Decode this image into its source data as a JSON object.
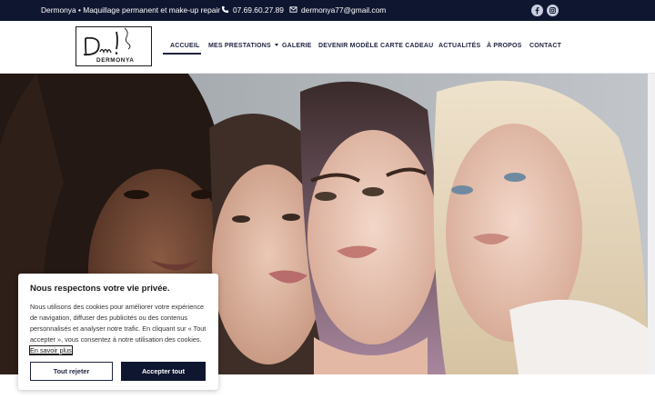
{
  "topbar": {
    "brand_line": "Dermonya • Maquillage permanent et make-up repair",
    "phone": "07.69.60.27.89",
    "email": "dermonya77@gmail.com",
    "phone_icon": "phone-icon",
    "email_icon": "envelope-icon",
    "social": [
      "facebook-icon",
      "instagram-icon"
    ]
  },
  "logo": {
    "script_text": "Dn!",
    "wordmark": "DERMONYA"
  },
  "nav": {
    "items": [
      {
        "label": "ACCUEIL",
        "active": true
      },
      {
        "label": "MES PRESTATIONS",
        "has_dropdown": true
      },
      {
        "label": "GALERIE"
      },
      {
        "label": "DEVENIR MODÈLE"
      },
      {
        "label": "CARTE CADEAU"
      },
      {
        "label": "ACTUALITÉS"
      },
      {
        "label": "À PROPOS"
      },
      {
        "label": "CONTACT"
      }
    ]
  },
  "hero": {
    "image": "four-women-portrait-photo"
  },
  "cookie": {
    "title": "Nous respectons votre vie privée.",
    "text": "Nous utilisons des cookies pour améliorer votre expérience de navigation, diffuser des publicités ou des contenus personnalisés et analyser notre trafic. En cliquant sur « Tout accepter », vous consentez à notre utilisation des cookies.",
    "link": "En savoir plus",
    "reject_label": "Tout rejeter",
    "accept_label": "Accepter tout"
  },
  "colors": {
    "navy": "#0f1630",
    "nav_text": "#1e2340"
  }
}
